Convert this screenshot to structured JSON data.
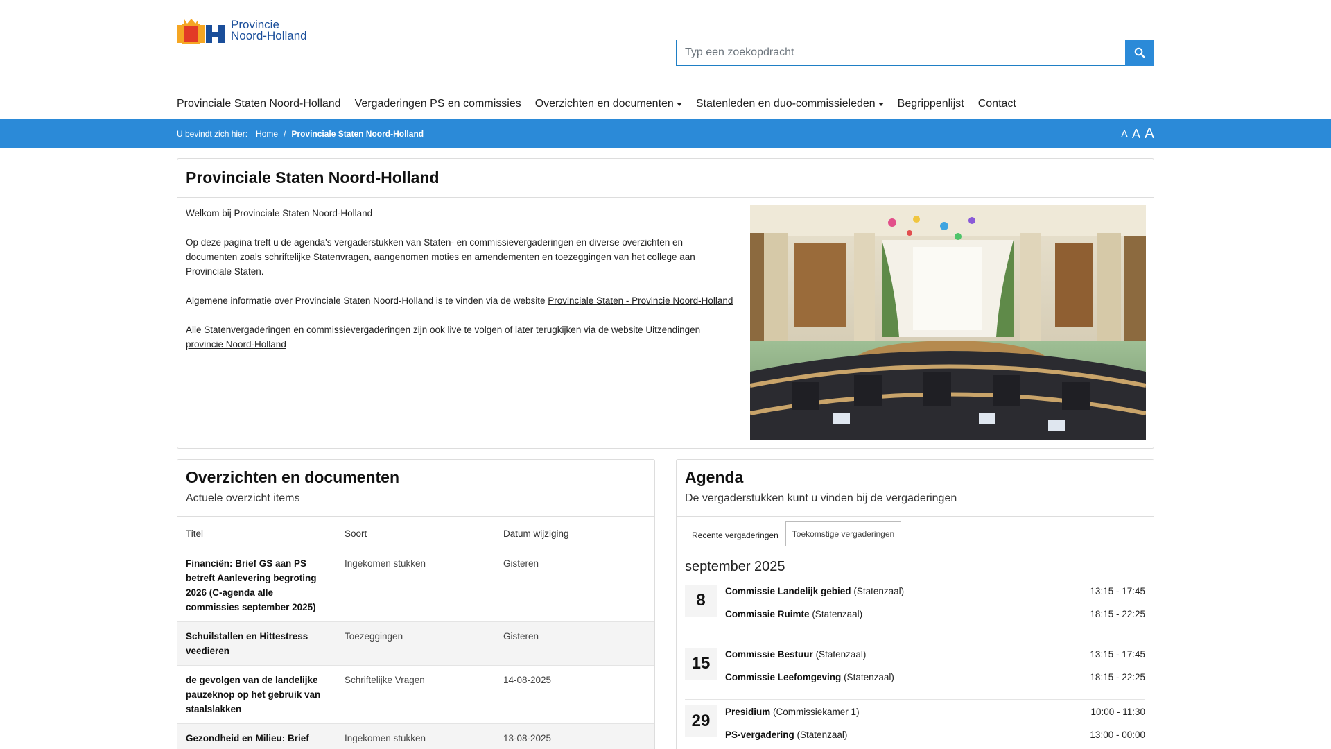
{
  "header": {
    "logo_line1": "Provincie",
    "logo_line2": "Noord-Holland",
    "search_placeholder": "Typ een zoekopdracht"
  },
  "nav": {
    "items": [
      {
        "label": "Provinciale Staten Noord-Holland",
        "dropdown": false
      },
      {
        "label": "Vergaderingen PS en commissies",
        "dropdown": false
      },
      {
        "label": "Overzichten en documenten",
        "dropdown": true
      },
      {
        "label": "Statenleden en duo-commissieleden",
        "dropdown": true
      },
      {
        "label": "Begrippenlijst",
        "dropdown": false
      },
      {
        "label": "Contact",
        "dropdown": false
      }
    ]
  },
  "breadcrumb": {
    "prefix": "U bevindt zich hier:",
    "home": "Home",
    "separator": "/",
    "current": "Provinciale Staten Noord-Holland",
    "font_small": "A",
    "font_medium": "A",
    "font_large": "A"
  },
  "intro": {
    "title": "Provinciale Staten Noord-Holland",
    "p1": "Welkom bij Provinciale Staten Noord-Holland",
    "p2": "Op deze pagina treft u de agenda's vergaderstukken van Staten- en commissievergaderingen en diverse overzichten en documenten zoals schriftelijke Statenvragen, aangenomen moties en amendementen en toezeggingen van het college aan Provinciale Staten.",
    "p3_text": "Algemene informatie over Provinciale Staten Noord-Holland is te vinden via de website ",
    "p3_link": "Provinciale Staten - Provincie Noord-Holland",
    "p4_text": "Alle Statenvergaderingen en commissievergaderingen zijn ook live te volgen of later terugkijken via de website ",
    "p4_link": "Uitzendingen provincie Noord-Holland"
  },
  "docs": {
    "title": "Overzichten en documenten",
    "subtitle": "Actuele overzicht items",
    "columns": [
      "Titel",
      "Soort",
      "Datum wijziging"
    ],
    "rows": [
      {
        "title": "Financiën: Brief GS aan PS betreft Aanlevering begroting 2026 (C-agenda alle commissies september 2025)",
        "kind": "Ingekomen stukken",
        "date": "Gisteren"
      },
      {
        "title": "Schuilstallen en Hittestress veedieren",
        "kind": "Toezeggingen",
        "date": "Gisteren"
      },
      {
        "title": "de gevolgen van de landelijke pauzeknop op het gebruik van staalslakken",
        "kind": "Schriftelijke Vragen",
        "date": "14-08-2025"
      },
      {
        "title": "Gezondheid en Milieu: Brief",
        "kind": "Ingekomen stukken",
        "date": "13-08-2025"
      }
    ]
  },
  "agenda": {
    "title": "Agenda",
    "subtitle": "De vergaderstukken kunt u vinden bij de vergaderingen",
    "tabs": [
      "Recente vergaderingen",
      "Toekomstige vergaderingen"
    ],
    "active_tab": 1,
    "month": "september 2025",
    "days": [
      {
        "day": "8",
        "events": [
          {
            "name": "Commissie Landelijk gebied",
            "room": "(Statenzaal)",
            "time": "13:15 - 17:45"
          },
          {
            "name": "Commissie Ruimte",
            "room": "(Statenzaal)",
            "time": "18:15 - 22:25"
          }
        ]
      },
      {
        "day": "15",
        "events": [
          {
            "name": "Commissie Bestuur",
            "room": "(Statenzaal)",
            "time": "13:15 - 17:45"
          },
          {
            "name": "Commissie Leefomgeving",
            "room": "(Statenzaal)",
            "time": "18:15 - 22:25"
          }
        ]
      },
      {
        "day": "29",
        "events": [
          {
            "name": "Presidium",
            "room": "(Commissiekamer 1)",
            "time": "10:00 - 11:30"
          },
          {
            "name": "PS-vergadering",
            "room": "(Statenzaal)",
            "time": "13:00 - 00:00"
          }
        ]
      }
    ]
  },
  "colors": {
    "brand_blue": "#2b8ad8",
    "logo_blue": "#1a4e9a",
    "logo_orange": "#f5a623"
  }
}
